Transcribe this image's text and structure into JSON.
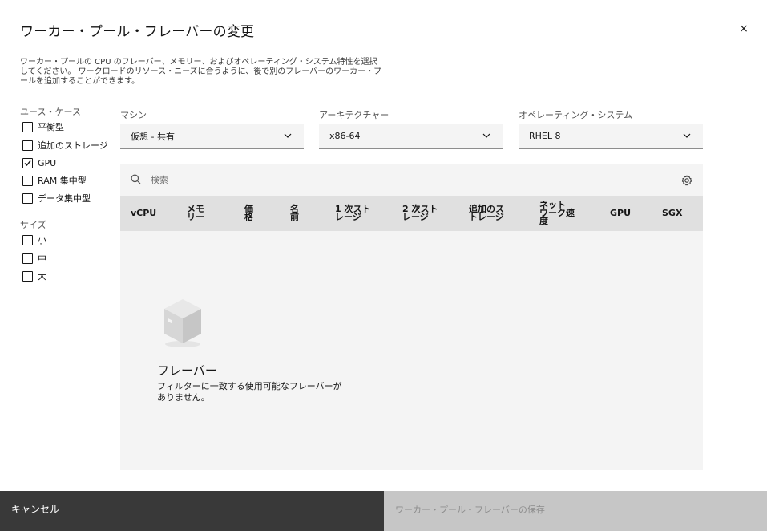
{
  "dialog": {
    "title": "ワーカー・プール・フレーバーの変更",
    "close_label": "×",
    "description": "ワーカー・プールの CPU のフレーバー、メモリー、およびオペレーティング・システム特性を選択してください。 ワークロードのリソース・ニーズに合うように、後で別のフレーバーのワーカー・プールを追加することができます。"
  },
  "filters": {
    "use_case": {
      "title": "ユース・ケース",
      "items": [
        {
          "label": "平衡型",
          "checked": false
        },
        {
          "label": "追加のストレージ",
          "checked": false
        },
        {
          "label": "GPU",
          "checked": true
        },
        {
          "label": "RAM 集中型",
          "checked": false
        },
        {
          "label": "データ集中型",
          "checked": false
        }
      ]
    },
    "size": {
      "title": "サイズ",
      "items": [
        {
          "label": "小",
          "checked": false
        },
        {
          "label": "中",
          "checked": false
        },
        {
          "label": "大",
          "checked": false
        }
      ]
    }
  },
  "selectors": {
    "machine": {
      "label": "マシン",
      "value": "仮想 - 共有"
    },
    "architecture": {
      "label": "アーキテクチャー",
      "value": "x86-64"
    },
    "os": {
      "label": "オペレーティング・システム",
      "value": "RHEL 8"
    }
  },
  "table": {
    "search_placeholder": "検索",
    "columns": [
      "vCPU",
      "メモ\nリー",
      "価\n格",
      "名\n前",
      "1 次スト\nレージ",
      "2 次スト\nレージ",
      "追加のス\nトレージ",
      "ネット\nワーク速\n度",
      "GPU",
      "SGX"
    ],
    "empty_state": {
      "title": "フレーバー",
      "text": "フィルターに一致する使用可能なフレーバーがありません。"
    }
  },
  "footer": {
    "cancel_label": "キャンセル",
    "save_label": "ワーカー・プール・フレーバーの保存"
  },
  "colors": {
    "cancel_bg": "#393939",
    "save_bg_disabled": "#c6c6c6",
    "table_bg": "#f4f4f4",
    "header_bg": "#e0e0e0"
  },
  "icons": [
    "close-icon",
    "checkmark-icon",
    "chevron-down-icon",
    "search-icon",
    "settings-icon",
    "package-box-icon"
  ]
}
